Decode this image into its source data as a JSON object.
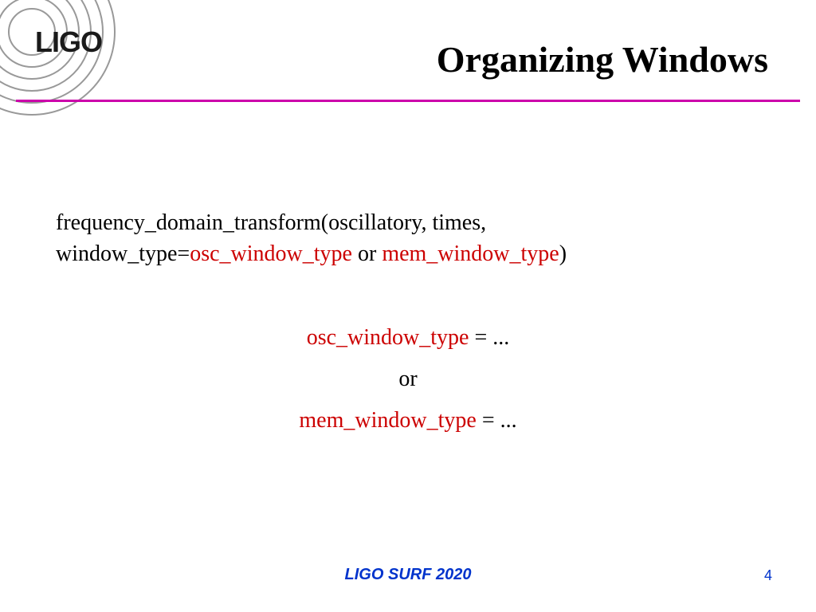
{
  "logo": {
    "text": "LIGO"
  },
  "title": "Organizing Windows",
  "content": {
    "line1_pre": "frequency_domain_transform(oscillatory, times, window_type=",
    "line1_red1": "osc_window_type",
    "line1_mid": " or ",
    "line1_red2": "mem_window_type",
    "line1_post": ")",
    "center1_red": "osc_window_type",
    "center1_rest": " = ...",
    "center_or": "or",
    "center2_red": "mem_window_type",
    "center2_rest": " = ..."
  },
  "footer": {
    "center": "LIGO SURF 2020",
    "page": "4"
  }
}
